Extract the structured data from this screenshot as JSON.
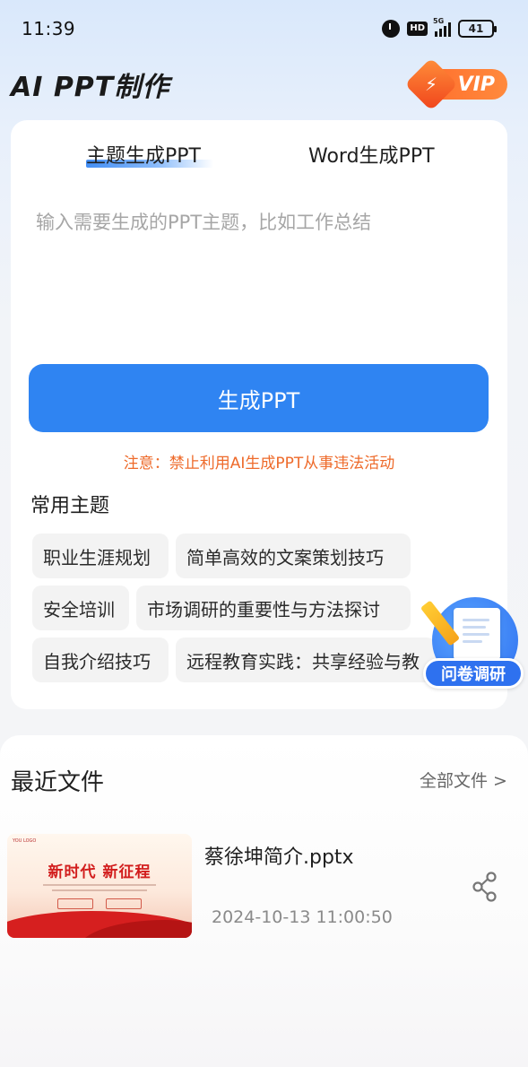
{
  "status_bar": {
    "time": "11:39",
    "hd_label": "HD",
    "network_label": "5G",
    "battery": "41"
  },
  "header": {
    "app_title": "AI PPT制作",
    "vip_label": "VIP"
  },
  "tabs": [
    {
      "label": "主题生成PPT",
      "active": true
    },
    {
      "label": "Word生成PPT",
      "active": false
    }
  ],
  "input": {
    "placeholder": "输入需要生成的PPT主题，比如工作总结",
    "value": ""
  },
  "generate_button": "生成PPT",
  "notice": "注意：禁止利用AI生成PPT从事违法活动",
  "common_topics": {
    "title": "常用主题",
    "items": [
      "职业生涯规划",
      "简单高效的文案策划技巧",
      "安全培训",
      "市场调研的重要性与方法探讨",
      "自我介绍技巧",
      "远程教育实践：共享经验与教"
    ]
  },
  "survey_badge": "问卷调研",
  "recent": {
    "title": "最近文件",
    "all_files_link": "全部文件 >",
    "files": [
      {
        "name": "蔡徐坤简介.pptx",
        "date": "2024-10-13 11:00:50",
        "thumbnail_title": "新时代  新征程",
        "thumbnail_logo": "YOU LOGO"
      }
    ]
  },
  "colors": {
    "accent": "#2f84f2",
    "warning": "#ee6a2a",
    "vip": "#ff6b2b"
  },
  "icons": [
    "alarm-icon",
    "hd-icon",
    "signal-icon",
    "battery-icon",
    "lightning-icon",
    "share-icon",
    "survey-icon"
  ]
}
